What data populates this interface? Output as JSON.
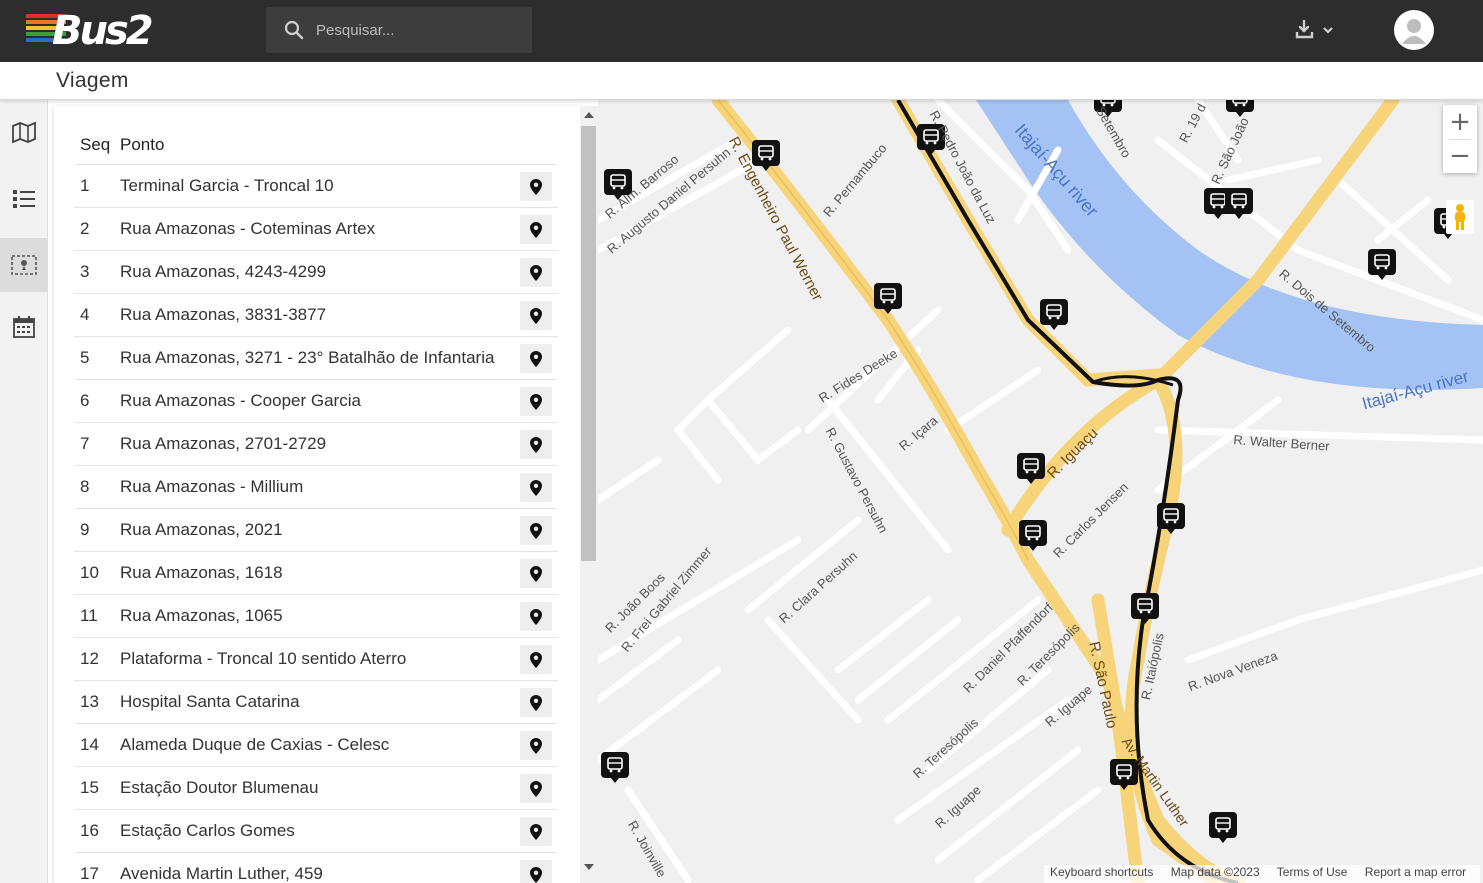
{
  "app": {
    "logo_text": "Bus2"
  },
  "search": {
    "placeholder": "Pesquisar..."
  },
  "header": {
    "download_icon": "download-icon",
    "avatar_icon": "user-avatar-icon"
  },
  "page": {
    "title": "Viagem"
  },
  "rail": {
    "items": [
      {
        "icon": "map-icon",
        "active": false
      },
      {
        "icon": "list-icon",
        "active": false
      },
      {
        "icon": "route-icon",
        "active": true
      },
      {
        "icon": "calendar-icon",
        "active": false
      }
    ]
  },
  "table": {
    "headers": {
      "seq": "Seq",
      "ponto": "Ponto"
    },
    "rows": [
      {
        "seq": "1",
        "name": "Terminal Garcia - Troncal 10"
      },
      {
        "seq": "2",
        "name": "Rua Amazonas - Coteminas Artex"
      },
      {
        "seq": "3",
        "name": "Rua Amazonas, 4243-4299"
      },
      {
        "seq": "4",
        "name": "Rua Amazonas, 3831-3877"
      },
      {
        "seq": "5",
        "name": "Rua Amazonas, 3271 - 23° Batalhão de Infantaria"
      },
      {
        "seq": "6",
        "name": "Rua Amazonas - Cooper Garcia"
      },
      {
        "seq": "7",
        "name": "Rua Amazonas, 2701-2729"
      },
      {
        "seq": "8",
        "name": "Rua Amazonas - Millium"
      },
      {
        "seq": "9",
        "name": "Rua Amazonas, 2021"
      },
      {
        "seq": "10",
        "name": "Rua Amazonas, 1618"
      },
      {
        "seq": "11",
        "name": "Rua Amazonas, 1065"
      },
      {
        "seq": "12",
        "name": "Plataforma - Troncal 10 sentido Aterro"
      },
      {
        "seq": "13",
        "name": "Hospital Santa Catarina"
      },
      {
        "seq": "14",
        "name": "Alameda Duque de Caxias - Celesc"
      },
      {
        "seq": "15",
        "name": "Estação Doutor Blumenau"
      },
      {
        "seq": "16",
        "name": "Estação Carlos Gomes"
      },
      {
        "seq": "17",
        "name": "Avenida Martin Luther, 459"
      }
    ]
  },
  "map": {
    "zoom_in": "+",
    "zoom_out": "−",
    "labels": {
      "river1": "Itajaí-Açu river",
      "river2": "Itajaí-Açu river",
      "road_paul_werner": "R. Engenheiro Paul Werner",
      "road_pernambuco": "R. Pernambuco",
      "road_pedro": "R. Pedro João da Luz",
      "road_augusto": "R. Augusto Daniel Persuhn",
      "road_barroso": "R. Alm. Barroso",
      "road_fides": "R. Fides Deeke",
      "road_icara": "R. Içara",
      "road_gustavo": "R. Gustavo Persuhn",
      "road_iguacu": "R. Iguaçu",
      "road_carlos": "R. Carlos Jensen",
      "road_clara": "R. Clara Persuhn",
      "road_frei": "R. Frei Gabriel Zimmer",
      "road_joao": "R. João Boos",
      "road_daniel": "R. Daniel Pfaffendorf",
      "road_teresopolis1": "R. Teresópolis",
      "road_teresopolis2": "R. Teresópolis",
      "road_iguape1": "R. Iguape",
      "road_iguape2": "R. Iguape",
      "road_sao_paulo": "R. São Paulo",
      "road_itaiopolis": "R. Itaiópolis",
      "road_nova_veneza": "R. Nova Veneza",
      "road_walter": "R. Walter Berner",
      "road_dois_setembro": "R. Dois de Setembro",
      "road_martin": "Av. Martin Luther",
      "road_joinville": "R. Joinville",
      "road_setembro": "Setembro",
      "road_19": "R. 19 d",
      "road_sao_joao": "R. São João"
    },
    "attribution": {
      "shortcuts": "Keyboard shortcuts",
      "data": "Map data ©2023",
      "terms": "Terms of Use",
      "report": "Report a map error"
    }
  }
}
